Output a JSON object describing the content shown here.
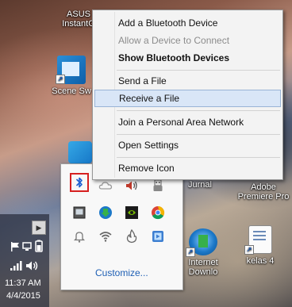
{
  "desktop": {
    "icons": [
      {
        "label": "ASUS",
        "sub": "InstantG"
      },
      {
        "label": "Scene Sw"
      },
      {
        "label": "Jurnal"
      },
      {
        "label": "Adobe",
        "sub": "Premiere Pro"
      },
      {
        "label": "Internet",
        "sub": "Downlo"
      },
      {
        "label": "kelas 4"
      }
    ]
  },
  "context_menu": {
    "items": [
      {
        "label": "Add a Bluetooth Device"
      },
      {
        "label": "Allow a Device to Connect"
      },
      {
        "label": "Show Bluetooth Devices"
      },
      {
        "label": "Send a File"
      },
      {
        "label": "Receive a File"
      },
      {
        "label": "Join a Personal Area Network"
      },
      {
        "label": "Open Settings"
      },
      {
        "label": "Remove Icon"
      }
    ]
  },
  "tray_flyout": {
    "customize_label": "Customize..."
  },
  "taskbar": {
    "time": "11:37 AM",
    "date": "4/4/2015"
  },
  "colors": {
    "highlight": "#d9e6f7",
    "bluetooth": "#1f5fd0",
    "link": "#1e5fb4",
    "frame": "#d62020"
  }
}
